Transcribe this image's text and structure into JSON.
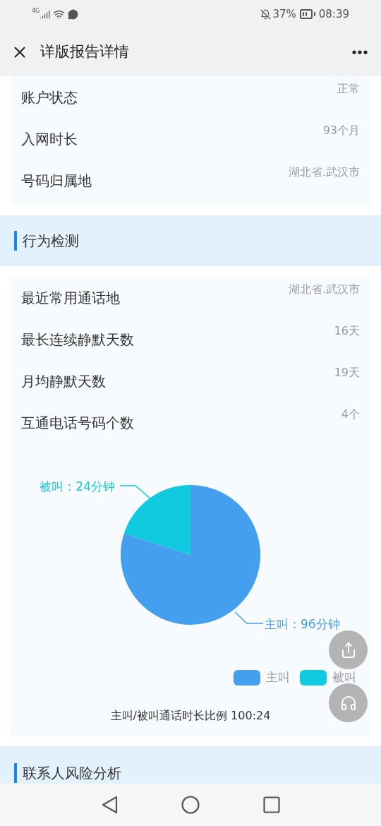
{
  "status_bar": {
    "network": "4G",
    "battery": "37%",
    "time": "08:39"
  },
  "header": {
    "title": "详版报告详情"
  },
  "account_rows": [
    {
      "label": "账户状态",
      "value": "正常"
    },
    {
      "label": "入网时长",
      "value": "93个月"
    },
    {
      "label": "号码归属地",
      "value": "湖北省.武汉市"
    }
  ],
  "behavior_section": {
    "title": "行为检测",
    "rows": [
      {
        "label": "最近常用通话地",
        "value": "湖北省.武汉市"
      },
      {
        "label": "最长连续静默天数",
        "value": "16天"
      },
      {
        "label": "月均静默天数",
        "value": "19天"
      },
      {
        "label": "互通电话号码个数",
        "value": "4个"
      }
    ],
    "chart_data": {
      "type": "pie",
      "categories": [
        "主叫",
        "被叫"
      ],
      "series": [
        {
          "colors": [
            "#449fee",
            "#10cbdf"
          ],
          "values": [
            80,
            20
          ]
        }
      ],
      "value_labels": [
        "主叫：96分钟",
        "被叫：24分钟"
      ],
      "legend": "bottom-right"
    },
    "caption": "主叫/被叫通话时长比例 100:24"
  },
  "contact_section": {
    "title": "联系人风险分析"
  }
}
